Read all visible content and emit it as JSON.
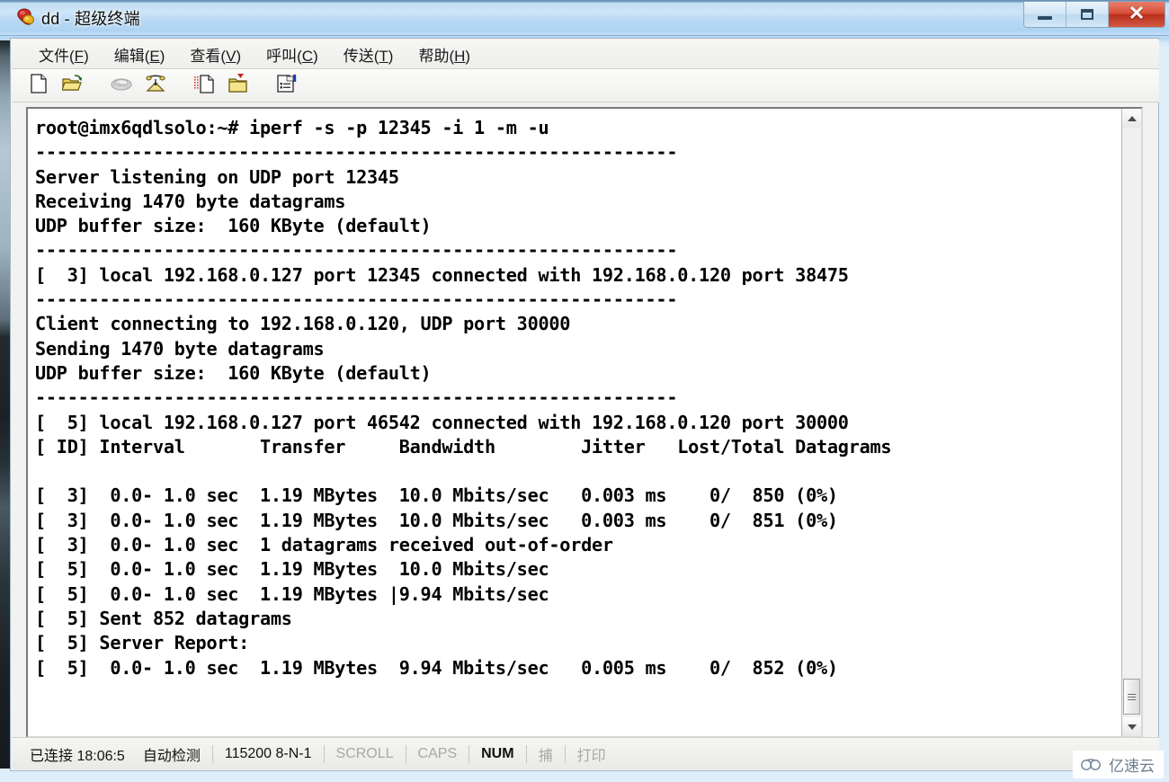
{
  "window": {
    "title": "dd - 超级终端",
    "icon": "hyperterminal-icon",
    "controls": {
      "minimize": "—",
      "maximize": "□",
      "close": "✕"
    }
  },
  "menubar": {
    "items": [
      {
        "label": "文件(F)",
        "pre": "文件(",
        "key": "F",
        "post": ")"
      },
      {
        "label": "编辑(E)",
        "pre": "编辑(",
        "key": "E",
        "post": ")"
      },
      {
        "label": "查看(V)",
        "pre": "查看(",
        "key": "V",
        "post": ")"
      },
      {
        "label": "呼叫(C)",
        "pre": "呼叫(",
        "key": "C",
        "post": ")"
      },
      {
        "label": "传送(T)",
        "pre": "传送(",
        "key": "T",
        "post": ")"
      },
      {
        "label": "帮助(H)",
        "pre": "帮助(",
        "key": "H",
        "post": ")"
      }
    ]
  },
  "toolbar": {
    "buttons": [
      {
        "name": "new-connection-icon",
        "enabled": true
      },
      {
        "name": "open-folder-icon",
        "enabled": true
      },
      {
        "name": "disconnect-phone-icon",
        "enabled": false
      },
      {
        "name": "call-phone-icon",
        "enabled": true
      },
      {
        "name": "send-file-icon",
        "enabled": true
      },
      {
        "name": "receive-file-icon",
        "enabled": true
      },
      {
        "name": "properties-icon",
        "enabled": true
      }
    ]
  },
  "terminal": {
    "lines": [
      "root@imx6qdlsolo:~# iperf -s -p 12345 -i 1 -m -u",
      "------------------------------------------------------------",
      "Server listening on UDP port 12345",
      "Receiving 1470 byte datagrams",
      "UDP buffer size:  160 KByte (default)",
      "------------------------------------------------------------",
      "[  3] local 192.168.0.127 port 12345 connected with 192.168.0.120 port 38475",
      "------------------------------------------------------------",
      "Client connecting to 192.168.0.120, UDP port 30000",
      "Sending 1470 byte datagrams",
      "UDP buffer size:  160 KByte (default)",
      "------------------------------------------------------------",
      "[  5] local 192.168.0.127 port 46542 connected with 192.168.0.120 port 30000",
      "[ ID] Interval       Transfer     Bandwidth        Jitter   Lost/Total Datagrams",
      "",
      "[  3]  0.0- 1.0 sec  1.19 MBytes  10.0 Mbits/sec   0.003 ms    0/  850 (0%)",
      "[  3]  0.0- 1.0 sec  1.19 MBytes  10.0 Mbits/sec   0.003 ms    0/  851 (0%)",
      "[  3]  0.0- 1.0 sec  1 datagrams received out-of-order",
      "[  5]  0.0- 1.0 sec  1.19 MBytes  10.0 Mbits/sec",
      "[  5]  0.0- 1.0 sec  1.19 MBytes |9.94 Mbits/sec",
      "[  5] Sent 852 datagrams",
      "[  5] Server Report:",
      "[  5]  0.0- 1.0 sec  1.19 MBytes  9.94 Mbits/sec   0.005 ms    0/  852 (0%)"
    ],
    "scrollbar": {
      "up_arrow": "▲",
      "down_arrow": "▼"
    }
  },
  "statusbar": {
    "connected": "已连接 18:06:5",
    "detect": "自动检测",
    "serial": "115200 8-N-1",
    "scroll": "SCROLL",
    "caps": "CAPS",
    "num": "NUM",
    "capture": "捕",
    "print": "打印"
  },
  "watermark": {
    "text": "亿速云"
  },
  "colors": {
    "titlebar_accent": "#bcd9ef",
    "close_button": "#d8503a",
    "terminal_bg": "#ffffff",
    "terminal_fg": "#000000",
    "status_dim": "#a8a8a8"
  }
}
